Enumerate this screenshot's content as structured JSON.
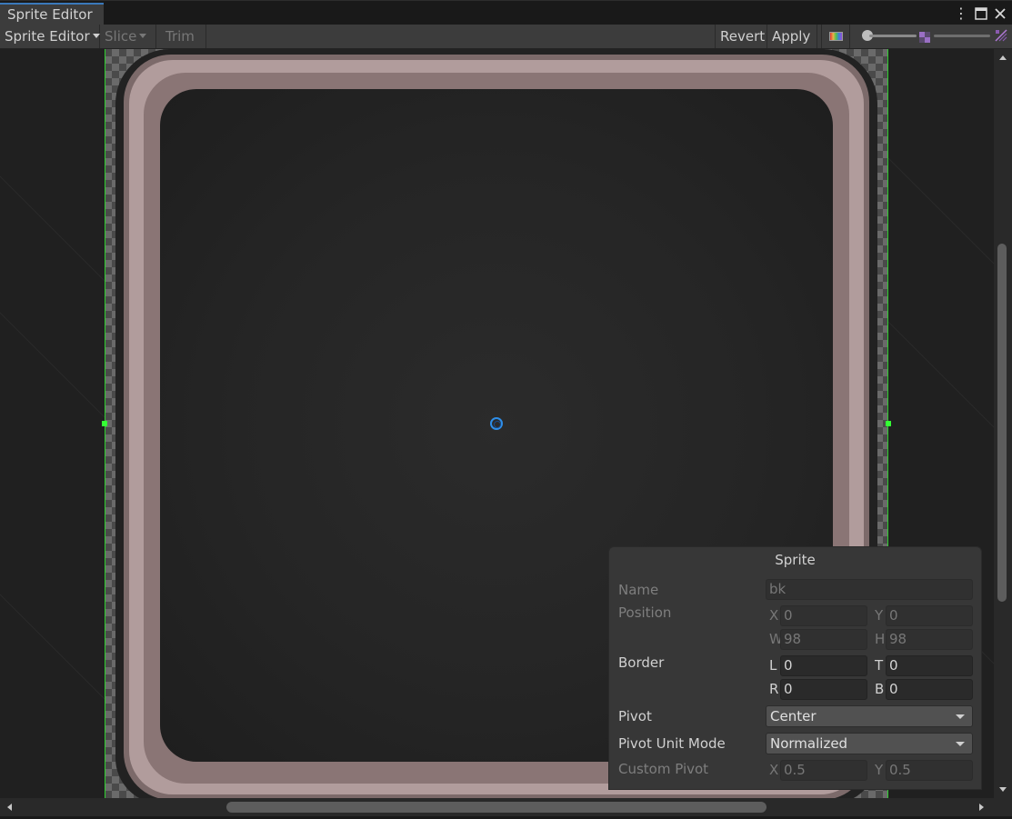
{
  "window": {
    "tab_title": "Sprite Editor",
    "menu_icon": "kebab-menu-icon",
    "maximize_icon": "maximize-icon",
    "close_icon": "close-icon"
  },
  "toolbar": {
    "mode_label": "Sprite Editor",
    "slice_label": "Slice",
    "trim_label": "Trim",
    "revert_label": "Revert",
    "apply_label": "Apply",
    "color_icon": "rgb-channels-icon",
    "mip_icon": "mipmap-icon",
    "alpha_icon": "alpha-icon"
  },
  "sprite_panel": {
    "title": "Sprite",
    "name_label": "Name",
    "name_value": "bk",
    "position_label": "Position",
    "position": {
      "x_label": "X",
      "x": "0",
      "y_label": "Y",
      "y": "0",
      "w_label": "W",
      "w": "98",
      "h_label": "H",
      "h": "98"
    },
    "border_label": "Border",
    "border": {
      "l_label": "L",
      "l": "0",
      "t_label": "T",
      "t": "0",
      "r_label": "R",
      "r": "0",
      "b_label": "B",
      "b": "0"
    },
    "pivot_label": "Pivot",
    "pivot_value": "Center",
    "pivot_unit_mode_label": "Pivot Unit Mode",
    "pivot_unit_mode_value": "Normalized",
    "custom_pivot_label": "Custom Pivot",
    "custom_pivot": {
      "x_label": "X",
      "x": "0.5",
      "y_label": "Y",
      "y": "0.5"
    }
  },
  "colors": {
    "accent": "#3a79bb",
    "sprite_outline": "#2fcf2f",
    "pivot": "#2e8ee8"
  }
}
